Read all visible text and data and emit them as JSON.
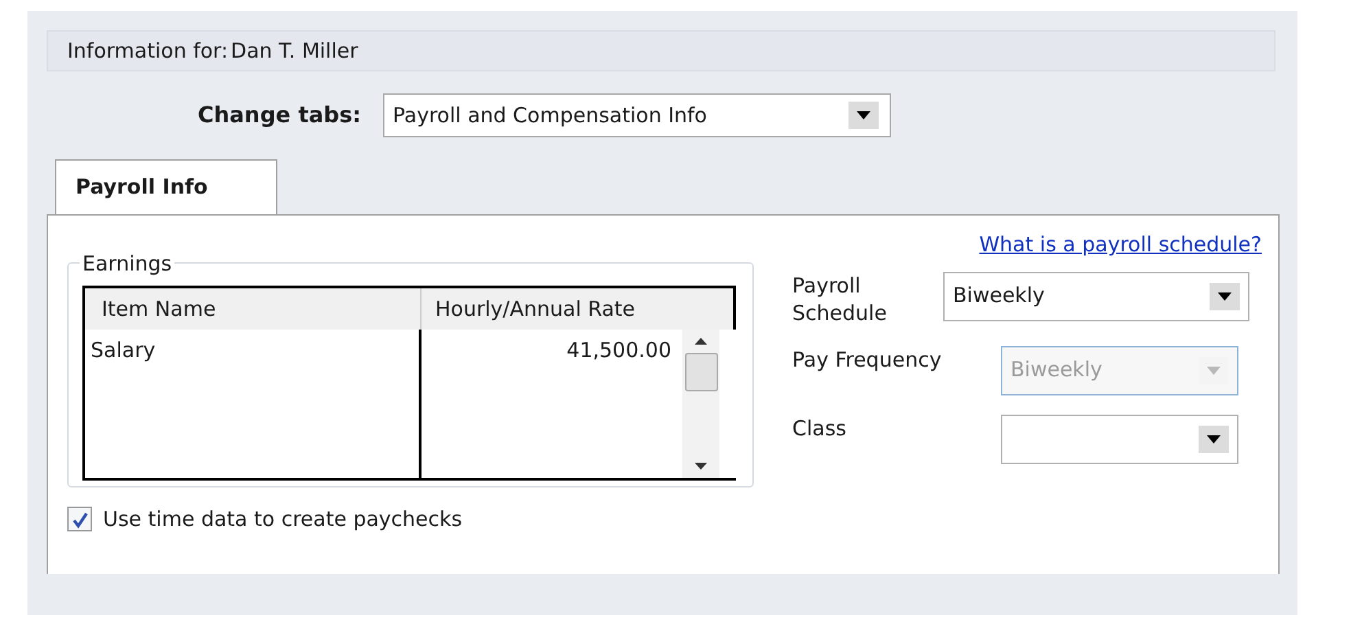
{
  "header": {
    "label": "Information for:",
    "name": "Dan T. Miller"
  },
  "change_tabs": {
    "label": "Change tabs:",
    "value": "Payroll and Compensation Info"
  },
  "tabs": [
    {
      "label": "Payroll Info",
      "selected": true
    }
  ],
  "earnings": {
    "title": "Earnings",
    "columns": [
      "Item Name",
      "Hourly/Annual Rate"
    ],
    "rows": [
      {
        "item_name": "Salary",
        "rate": "41,500.00"
      }
    ]
  },
  "use_time_data": {
    "label": "Use time data to create paychecks",
    "checked": true
  },
  "help_link": "What is a payroll schedule?",
  "fields": [
    {
      "label": "Payroll Schedule",
      "value": "Biweekly",
      "disabled": false
    },
    {
      "label": "Pay Frequency",
      "value": "Biweekly",
      "disabled": true
    },
    {
      "label": "Class",
      "disabled": false
    }
  ]
}
